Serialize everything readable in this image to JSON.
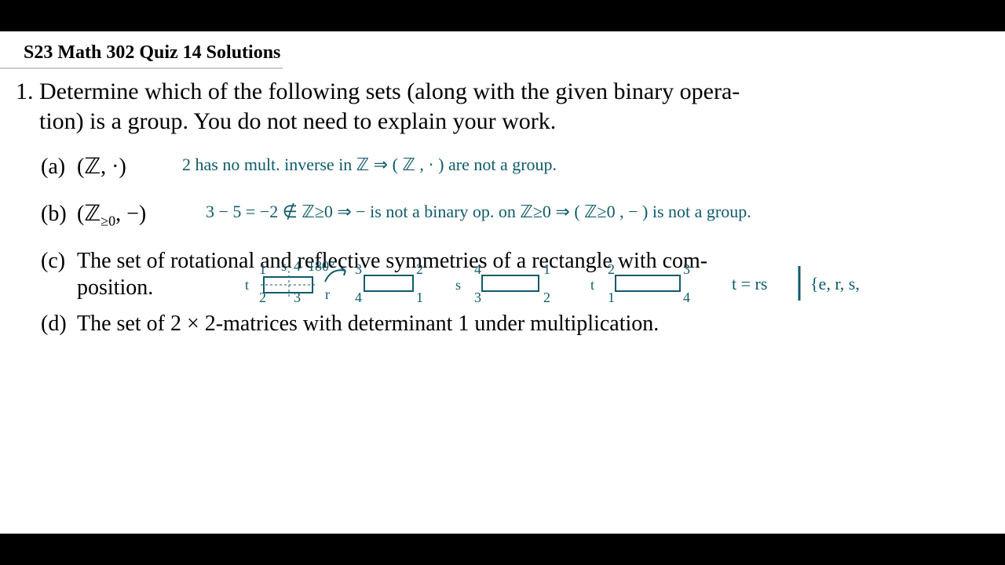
{
  "title": "S23 Math 302 Quiz 14 Solutions",
  "question": {
    "number": "1.",
    "stem_line1": "Determine which of the following sets (along with the given binary opera-",
    "stem_line2": "tion) is a group.  You do not need to explain your work."
  },
  "items": {
    "a": {
      "label": "(a)",
      "printed": "(ℤ, ·)",
      "hand": "2  has  no  mult.  inverse  in  ℤ    ⇒  ( ℤ , · )  are  not  a  group."
    },
    "b": {
      "label": "(b)",
      "printed_prefix": "(ℤ",
      "printed_sub": "≥0",
      "printed_suffix": ", −)",
      "hand": "3 − 5 = −2  ∉  ℤ≥0   ⇒   −  is  not  a  binary  op.  on  ℤ≥0   ⇒   ( ℤ≥0 , − )  is not a  group."
    },
    "c": {
      "label": "(c)",
      "printed_line1": "The set of rotational and reflective symmetries of a rectangle with com-",
      "printed_line2": "position.",
      "diagram": {
        "t_label": "t",
        "r_label": "r",
        "s_label": "s",
        "angle": "180°",
        "corners": [
          "1",
          "2",
          "3",
          "4"
        ],
        "result": "t = rs",
        "set": "{e, r, s,"
      }
    },
    "d": {
      "label": "(d)",
      "printed": "The set of 2 × 2-matrices with determinant 1 under multiplication."
    }
  },
  "colors": {
    "ink": "#0f5b6a"
  }
}
